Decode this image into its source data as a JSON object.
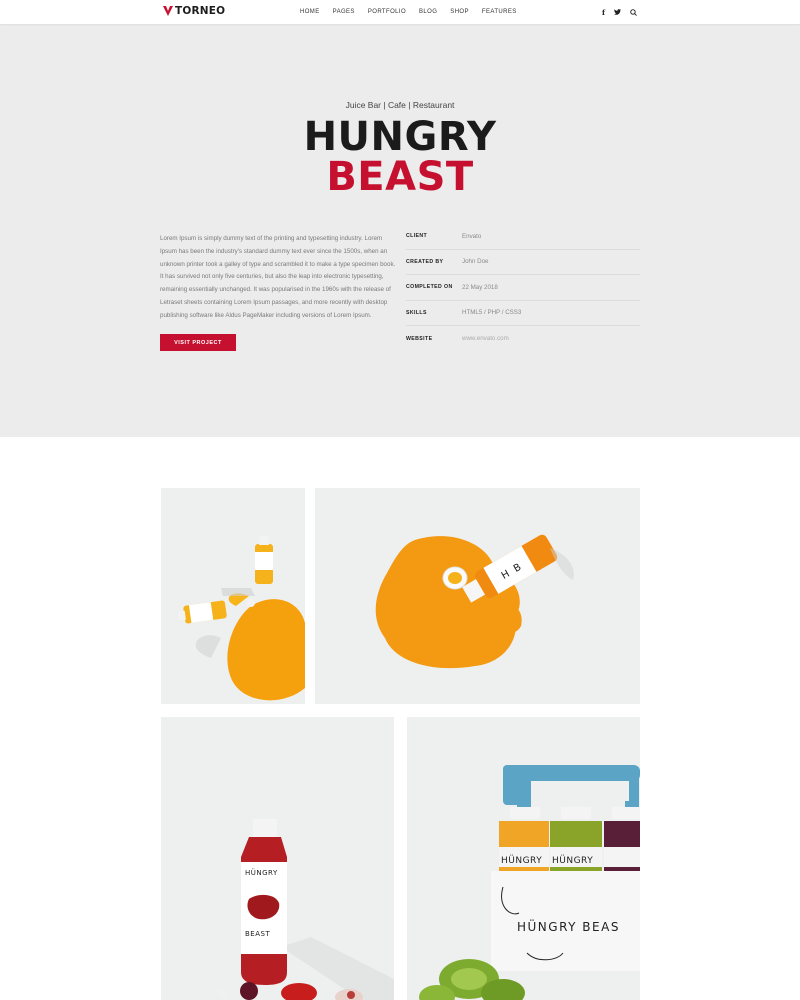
{
  "header": {
    "brand": "TORNEO",
    "nav": [
      "HOME",
      "PAGES",
      "PORTFOLIO",
      "BLOG",
      "SHOP",
      "FEATURES"
    ],
    "social": {
      "facebook": "f",
      "twitter": "🐦"
    }
  },
  "hero": {
    "subtitle": "Juice Bar | Cafe | Restaurant",
    "title_line1": "HUNGRY",
    "title_line2": "BEAST",
    "description": "Lorem Ipsum is simply dummy text of the printing and typesetting industry. Lorem Ipsum has been the industry's standard dummy text ever since the 1500s, when an unknown printer took a galley of type and scrambled it to make a type specimen book. It has survived not only five centuries, but also the leap into electronic typesetting, remaining essentially unchanged. It was popularised in the 1960s with the release of Letraset sheets containing Lorem Ipsum passages, and more recently with desktop publishing software like Aldus PageMaker including versions of Lorem Ipsum.",
    "button": "VISIT PROJECT"
  },
  "meta": [
    {
      "label": "CLIENT",
      "value": "Envato"
    },
    {
      "label": "CREATED BY",
      "value": "John Doe"
    },
    {
      "label": "COMPLETED ON",
      "value": "22 May 2018"
    },
    {
      "label": "SKILLS",
      "value": "HTML5 / PHP / CSS3"
    },
    {
      "label": "WEBSITE",
      "value": "www.envato.com"
    }
  ],
  "gallery": {
    "bottle_brand_1": "HÜNGRY",
    "bottle_brand_2": "BEAST",
    "box_text": "HÜNGRY   BEAS",
    "bottle_letter_h": "H",
    "bottle_letter_b": "B"
  },
  "colors": {
    "accent": "#c5102f",
    "hero_bg": "#ececec",
    "juice": "#f39a12"
  }
}
